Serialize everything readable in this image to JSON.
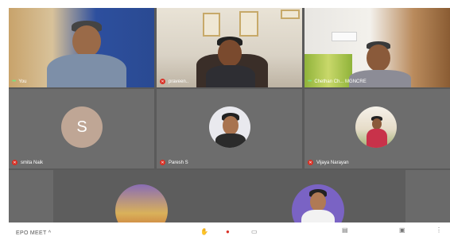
{
  "tiles": [
    {
      "name": "You",
      "muted": false
    },
    {
      "name": "praveen..",
      "muted": true
    },
    {
      "name": "Chethan Ch... MGNCRE",
      "muted": false
    },
    {
      "name": "smita Naik",
      "muted": true,
      "initial": "S"
    },
    {
      "name": "Paresh S",
      "muted": true
    },
    {
      "name": "Vijaya Narayan",
      "muted": true
    }
  ],
  "bottom_bar": {
    "meeting_code": "EPO MEET ^"
  },
  "colors": {
    "stage": "#5a5a5a",
    "tile": "#6d6d6d",
    "muted_red": "#d93025",
    "speaking_green": "#7ee07e",
    "avatar_s": "#bfa695"
  }
}
